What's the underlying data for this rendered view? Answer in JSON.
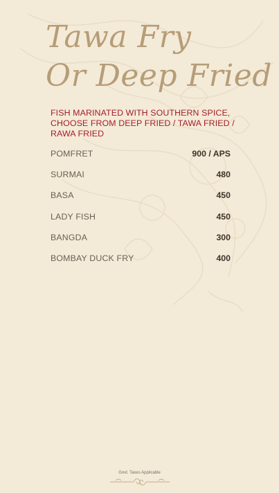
{
  "title": {
    "line1": "Tawa Fry",
    "line2": "Or Deep Fried"
  },
  "description": "FISH MARINATED WITH SOUTHERN SPICE, CHOOSE FROM DEEP FRIED / TAWA FRIED / RAWA FRIED",
  "items": [
    {
      "name": "POMFRET",
      "price": "900 / APS"
    },
    {
      "name": "SURMAI",
      "price": "480"
    },
    {
      "name": "BASA",
      "price": "450"
    },
    {
      "name": "LADY FISH",
      "price": "450"
    },
    {
      "name": "BANGDA",
      "price": "300"
    },
    {
      "name": "BOMBAY DUCK FRY",
      "price": "400"
    }
  ],
  "footer": {
    "note": "Govt. Taxes Applicable"
  },
  "colors": {
    "background": "#f4ead8",
    "title": "#b59d77",
    "description": "#a32028",
    "item_name": "#6b5f51",
    "price": "#3e342a"
  }
}
